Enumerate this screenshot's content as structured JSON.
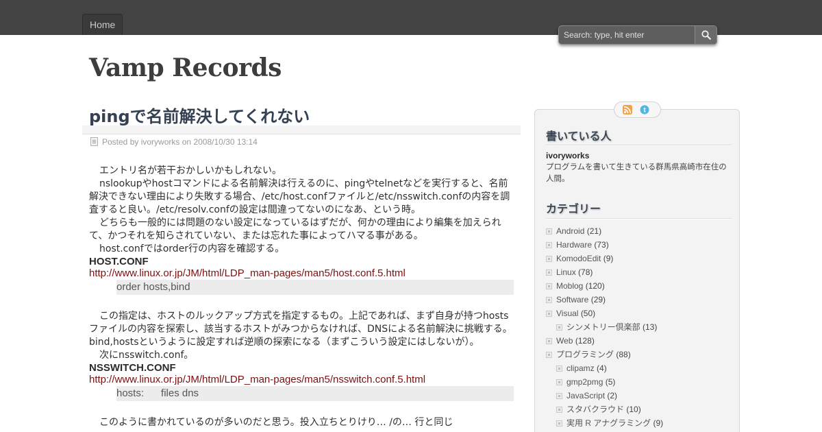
{
  "nav": {
    "home_label": "Home"
  },
  "search": {
    "placeholder": "Search: type, hit enter"
  },
  "site": {
    "title": "Vamp Records"
  },
  "post": {
    "title": "pingで名前解決してくれない",
    "meta_prefix": "Posted by",
    "author": "ivoryworks",
    "meta_on": "on",
    "date": "2008/10/30 13:14",
    "paragraphs": [
      "エントリ名が若干おかしいかもしれない。",
      "nslookupやhostコマンドによる名前解決は行えるのに、pingやtelnetなどを実行すると、名前解決できない理由により失敗する場合、/etc/host.confファイルと/etc/nsswitch.confの内容を調査すると良い。/etc/resolv.confの設定は間違ってないのになあ、という時。",
      "どちらも一般的には問題のない設定になっているはずだが、何かの理由により編集を加えられて、かつそれを知らされていない、または忘れた事によってハマる事がある。",
      "host.confではorder行の内容を確認する。"
    ],
    "section1": {
      "heading": "HOST.CONF",
      "link": "http://www.linux.or.jp/JM/html/LDP_man-pages/man5/host.conf.5.html",
      "code": "order hosts,bind"
    },
    "paragraphs2": [
      "この指定は、ホストのルックアップ方式を指定するもの。上記であれば、まず自身が持つhostsファイルの内容を探索し、該当するホストがみつからなければ、DNSによる名前解決に挑戦する。bind,hostsというように設定すれば逆順の探索になる（まずこういう設定にはしないが）。",
      "次にnsswitch.conf。"
    ],
    "section2": {
      "heading": "NSSWITCH.CONF",
      "link": "http://www.linux.or.jp/JM/html/LDP_man-pages/man5/nsswitch.conf.5.html",
      "code": "hosts:      files dns"
    },
    "trailing": "このように書かれているのが多いのだと思う。投入立ちとりけり… /の… 行と同じ"
  },
  "sidebar": {
    "feed_icons": [
      "rss-icon",
      "twitter-icon"
    ],
    "author_widget": {
      "title": "書いている人",
      "name": "ivoryworks",
      "description": "プログラムを書いて生きている群馬県高崎市在住の人間。"
    },
    "category_widget": {
      "title": "カテゴリー",
      "items": [
        {
          "label": "Android",
          "count": "(21)",
          "child": false
        },
        {
          "label": "Hardware",
          "count": "(73)",
          "child": false
        },
        {
          "label": "KomodoEdit",
          "count": "(9)",
          "child": false
        },
        {
          "label": "Linux",
          "count": "(78)",
          "child": false
        },
        {
          "label": "Moblog",
          "count": "(120)",
          "child": false
        },
        {
          "label": "Software",
          "count": "(29)",
          "child": false
        },
        {
          "label": "Visual",
          "count": "(50)",
          "child": false
        },
        {
          "label": "シンメトリー倶楽部",
          "count": "(13)",
          "child": true
        },
        {
          "label": "Web",
          "count": "(128)",
          "child": false
        },
        {
          "label": "プログラミング",
          "count": "(88)",
          "child": false
        },
        {
          "label": "clipamz",
          "count": "(4)",
          "child": true
        },
        {
          "label": "gmp2pmg",
          "count": "(5)",
          "child": true
        },
        {
          "label": "JavaScript",
          "count": "(2)",
          "child": true
        },
        {
          "label": "スタバクラウド",
          "count": "(10)",
          "child": true
        },
        {
          "label": "実用 R アナグラミング",
          "count": "(9)",
          "child": true
        }
      ]
    }
  },
  "colors": {
    "topbar": "#434343",
    "title": "#344152",
    "link": "#7a1010",
    "sidebar_bg": "#f3f3f3"
  }
}
